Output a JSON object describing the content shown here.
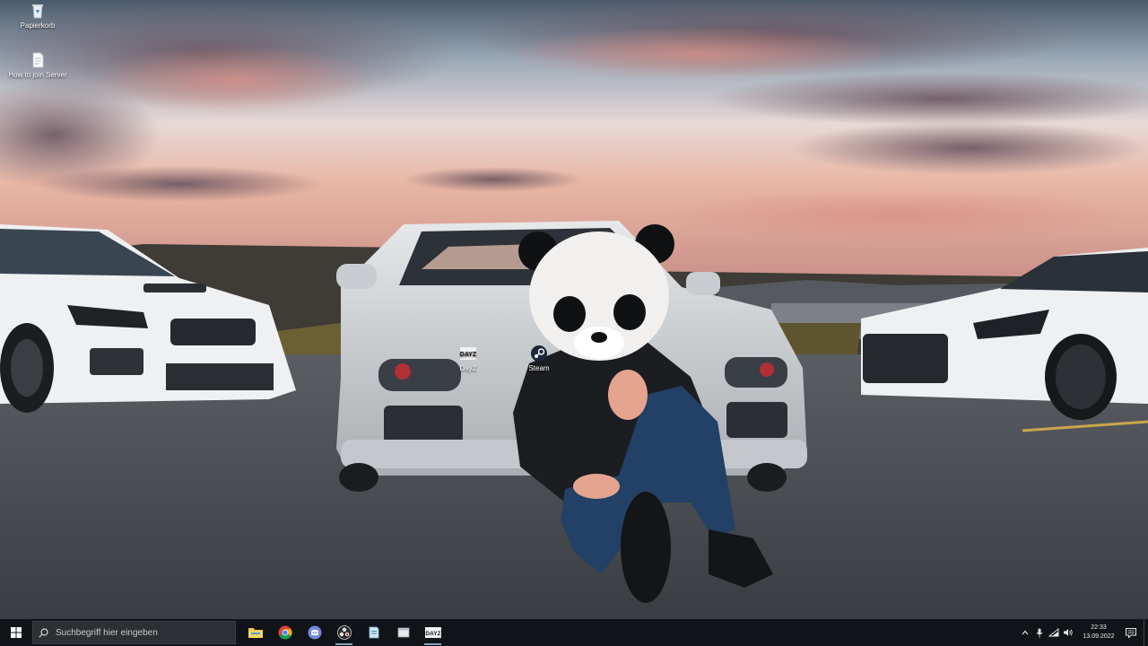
{
  "desktop": {
    "icons": [
      {
        "label": "Papierkorb",
        "icon": "recycle-bin-icon"
      },
      {
        "label": "How to join Server",
        "icon": "text-file-icon"
      },
      {
        "label": "DayZ",
        "icon": "dayz-logo-icon"
      },
      {
        "label": "Steam",
        "icon": "steam-icon"
      }
    ]
  },
  "taskbar": {
    "search_placeholder": "Suchbegriff hier eingeben",
    "pinned": [
      {
        "name": "file-explorer",
        "icon": "folder-icon"
      },
      {
        "name": "chrome",
        "icon": "chrome-icon"
      },
      {
        "name": "discord",
        "icon": "discord-icon"
      },
      {
        "name": "obs",
        "icon": "obs-icon"
      },
      {
        "name": "app-5",
        "icon": "document-app-icon"
      },
      {
        "name": "app-6",
        "icon": "window-app-icon"
      },
      {
        "name": "dayz",
        "icon": "dayz-logo-icon"
      }
    ],
    "tray": {
      "time": "22:33",
      "date": "13.09.2022"
    }
  },
  "colors": {
    "taskbar_bg": "#101418",
    "search_bg": "#2c2f33",
    "accent": "#8aa0b8"
  }
}
